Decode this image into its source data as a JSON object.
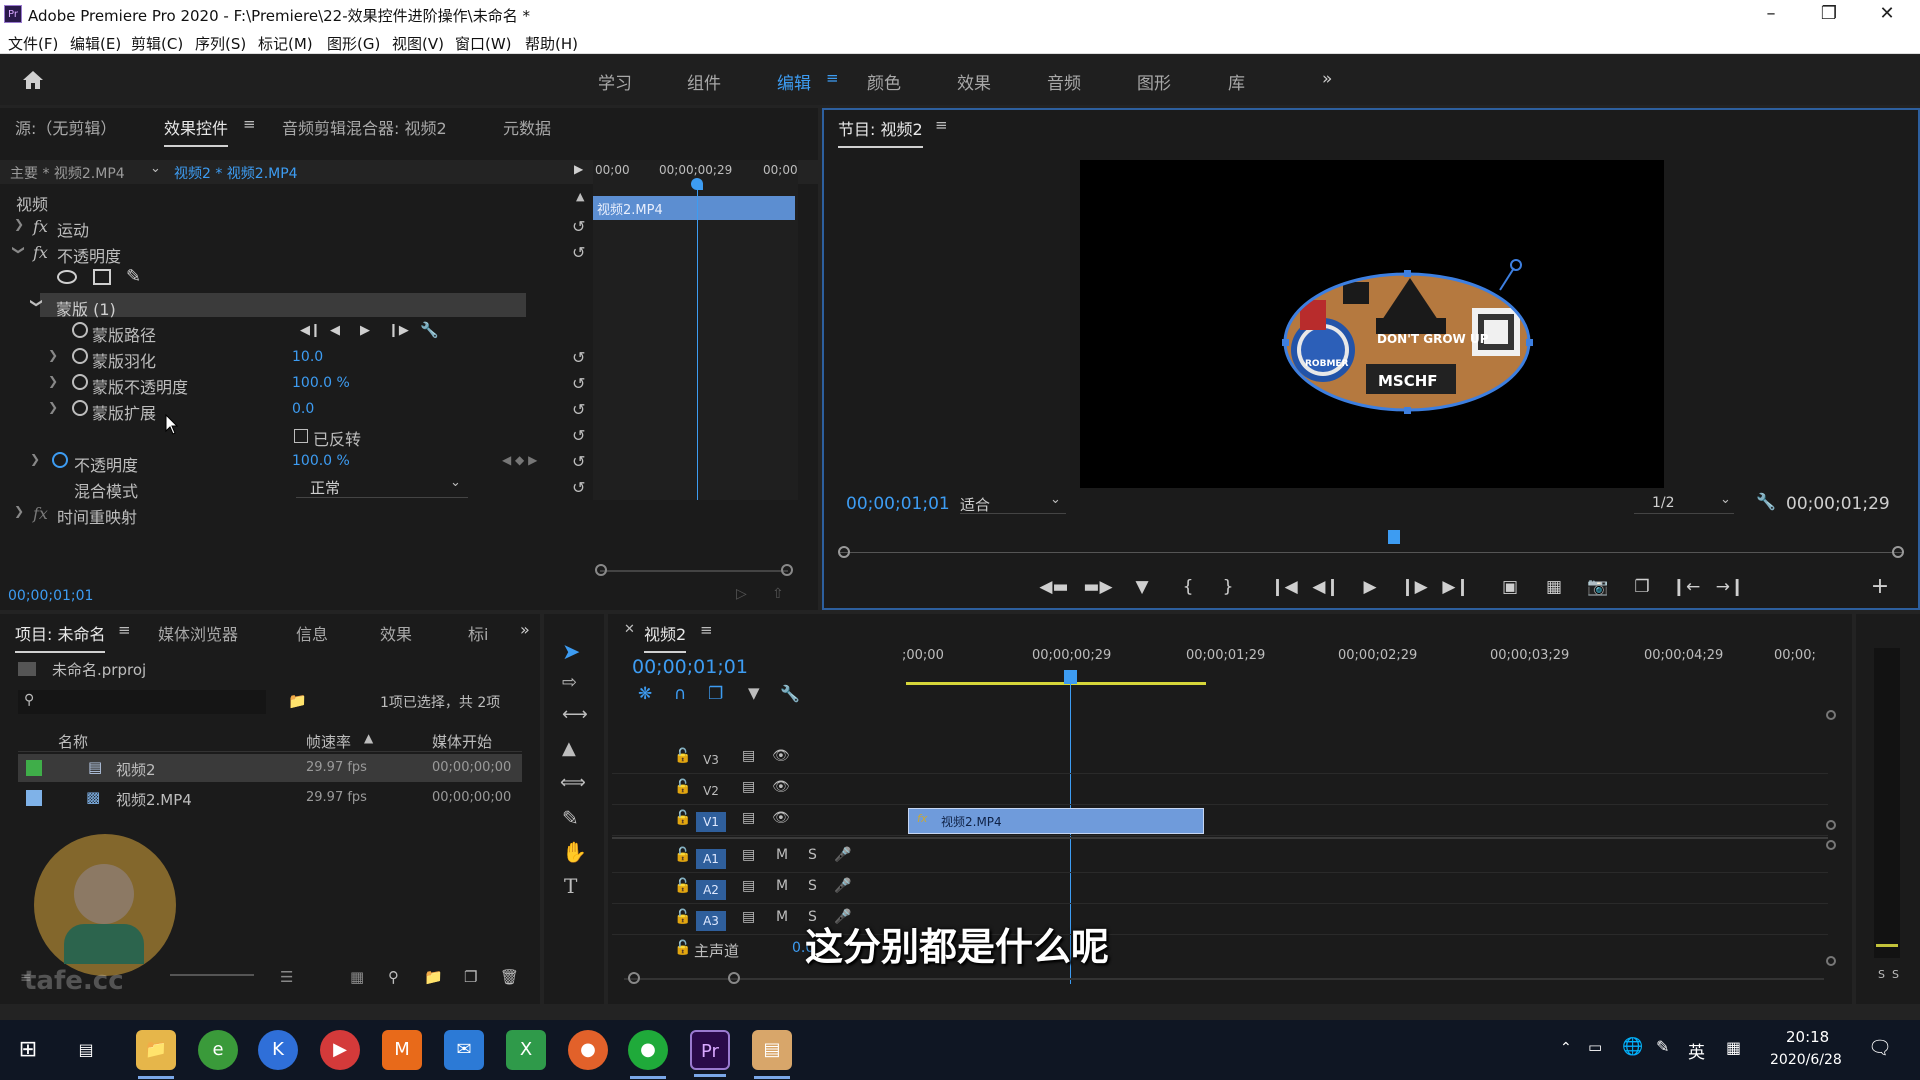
{
  "window": {
    "title": "Adobe Premiere Pro 2020 - F:\\Premiere\\22-效果控件进阶操作\\未命名 *",
    "app_icon": "Pr"
  },
  "menu": [
    "文件(F)",
    "编辑(E)",
    "剪辑(C)",
    "序列(S)",
    "标记(M)",
    "图形(G)",
    "视图(V)",
    "窗口(W)",
    "帮助(H)"
  ],
  "workspaces": {
    "items": [
      "学习",
      "组件",
      "编辑",
      "颜色",
      "效果",
      "音频",
      "图形",
      "库"
    ],
    "active": "编辑",
    "overflow": "»"
  },
  "source_panel": {
    "tabs": [
      "源:（无剪辑）",
      "效果控件",
      "音频剪辑混合器: 视频2",
      "元数据"
    ],
    "active_tab": "效果控件",
    "master_clip": "主要 * 视频2.MP4",
    "sequence_clip": "视频2 * 视频2.MP4",
    "mini_ruler": [
      "00;00",
      "00;00;00;29",
      "00;00"
    ],
    "mini_clip": "视频2.MP4",
    "section_video": "视频",
    "effects": {
      "motion": "运动",
      "opacity": "不透明度",
      "mask_name": "蒙版 (1)",
      "mask_path": "蒙版路径",
      "mask_feather": "蒙版羽化",
      "mask_feather_value": "10.0",
      "mask_opacity": "蒙版不透明度",
      "mask_opacity_value": "100.0 %",
      "mask_expansion": "蒙版扩展",
      "mask_expansion_value": "0.0",
      "inverted": "已反转",
      "opacity_param": "不透明度",
      "opacity_value": "100.0 %",
      "blend_mode": "混合模式",
      "blend_value": "正常",
      "time_remap": "时间重映射"
    },
    "timecode": "00;00;01;01"
  },
  "program_monitor": {
    "title": "节目: 视频2",
    "timecode": "00;00;01;01",
    "fit": "适合",
    "resolution": "1/2",
    "duration": "00;00;01;29",
    "video_texts": [
      "DON'T GROW UP",
      "MSCHF",
      "ROBMER"
    ]
  },
  "project_panel": {
    "tabs": [
      "项目: 未命名",
      "媒体浏览器",
      "信息",
      "效果",
      "标i"
    ],
    "active_tab": "项目: 未命名",
    "file": "未命名.prproj",
    "selection_info": "1项已选择，共 2项",
    "columns": [
      "名称",
      "帧速率",
      "媒体开始"
    ],
    "items": [
      {
        "name": "视频2",
        "fps": "29.97 fps",
        "start": "00;00;00;00",
        "color": "#3fae49"
      },
      {
        "name": "视频2.MP4",
        "fps": "29.97 fps",
        "start": "00;00;00;00",
        "color": "#7fb2e8"
      }
    ]
  },
  "timeline": {
    "tab": "视频2",
    "timecode": "00;00;01;01",
    "ruler": [
      ";00;00",
      "00;00;00;29",
      "00;00;01;29",
      "00;00;02;29",
      "00;00;03;29",
      "00;00;04;29",
      "00;00;"
    ],
    "video_tracks": [
      "V3",
      "V2",
      "V1"
    ],
    "audio_tracks": [
      "A1",
      "A2",
      "A3"
    ],
    "master": "主声道",
    "master_value": "0.0",
    "clip_name": "视频2.MP4",
    "track_buttons": {
      "mute": "M",
      "solo": "S"
    }
  },
  "subtitle": "这分别都是什么呢",
  "watermark": "tafe.cc",
  "audio_meter": {
    "labels": [
      "S",
      "S"
    ]
  },
  "taskbar": {
    "time": "20:18",
    "date": "2020/6/28",
    "ime": "英"
  }
}
